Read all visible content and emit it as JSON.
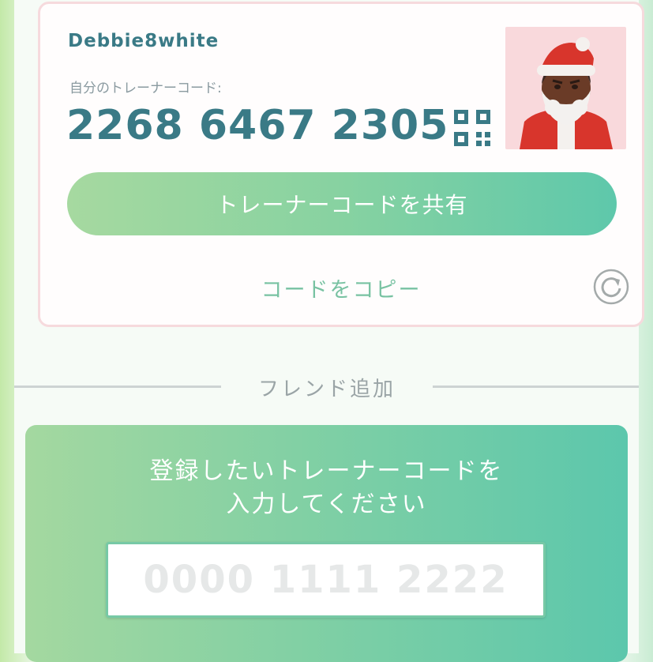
{
  "profile": {
    "username": "Debbie8white",
    "code_caption": "自分のトレーナーコード:",
    "trainer_code": "2268 6467 2305",
    "share_label": "トレーナーコードを共有",
    "copy_label": "コードをコピー"
  },
  "icons": {
    "qr": "qr-code-icon",
    "refresh": "refresh-icon",
    "avatar": "trainer-avatar-santa"
  },
  "friend_add": {
    "section_label": "フレンド追加",
    "prompt_line1": "登録したいトレーナーコードを",
    "prompt_line2": "入力してください",
    "input_placeholder": "0000 1111 2222",
    "input_value": ""
  },
  "colors": {
    "code_text": "#3a7a86",
    "accent_green": "#5ec8ab",
    "card_border": "#f6dadd"
  }
}
